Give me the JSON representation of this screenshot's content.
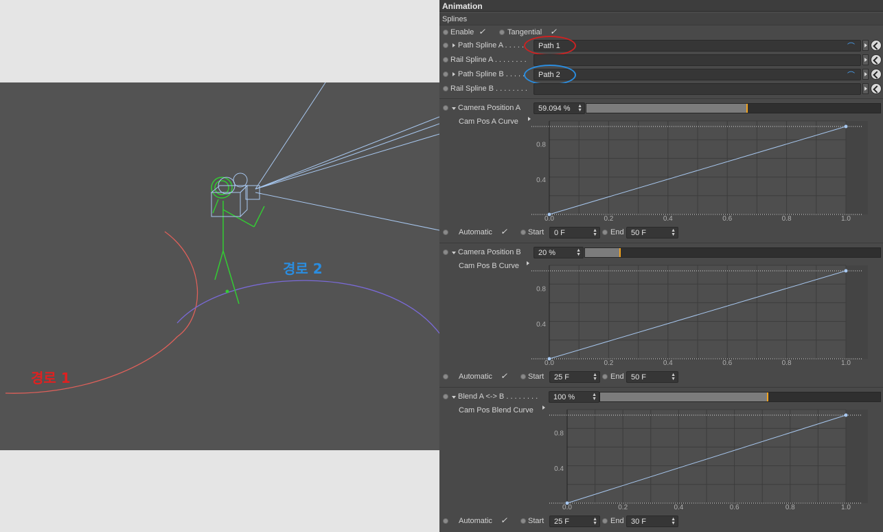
{
  "viewport": {
    "path1_label": "경로 1",
    "path2_label": "경로 2",
    "colors": {
      "path1": "#e0605a",
      "path2": "#7a6ad8",
      "label1": "#e02020",
      "label2": "#2a8de0",
      "figure": "#33cc33",
      "camera": "#a8c8f0",
      "background": "#535353"
    }
  },
  "panel": {
    "title": "Animation",
    "section": "Splines",
    "enable_label": "Enable",
    "tangential_label": "Tangential",
    "check_glyph": "✓",
    "path_spline_a_label": "Path Spline A . . . . .",
    "path_spline_a_value": "Path 1",
    "rail_spline_a_label": "Rail Spline A . . . . . . . .",
    "path_spline_b_label": "Path Spline B . . . . .",
    "path_spline_b_value": "Path 2",
    "rail_spline_b_label": "Rail Spline B . . . . . . . .",
    "highlight_colors": {
      "a": "#cc2222",
      "b": "#2a8de0"
    },
    "blocks": [
      {
        "param_label": "Camera Position A",
        "param_value": "59.094 %",
        "fill_fraction": 0.55,
        "curve_label": "Cam Pos A Curve",
        "automatic_label": "Automatic",
        "start_label": "Start",
        "start_value": "0 F",
        "end_label": "End",
        "end_value": "50 F",
        "y_ticks": [
          "0.8",
          "0.4"
        ],
        "x_ticks": [
          "0.0",
          "0.2",
          "0.4",
          "0.6",
          "0.8",
          "1.0"
        ]
      },
      {
        "param_label": "Camera Position B",
        "param_value": "20 %",
        "fill_fraction": 0.12,
        "curve_label": "Cam Pos B Curve",
        "automatic_label": "Automatic",
        "start_label": "Start",
        "start_value": "25 F",
        "end_label": "End",
        "end_value": "50 F",
        "y_ticks": [
          "0.8",
          "0.4"
        ],
        "x_ticks": [
          "0.0",
          "0.2",
          "0.4",
          "0.6",
          "0.8",
          "1.0"
        ]
      },
      {
        "param_label": "Blend A <-> B . . . . . . . .",
        "param_value": "100 %",
        "fill_fraction": 0.6,
        "curve_label": "Cam Pos Blend Curve",
        "automatic_label": "Automatic",
        "start_label": "Start",
        "start_value": "25 F",
        "end_label": "End",
        "end_value": "30 F",
        "y_ticks": [
          "0.8",
          "0.4"
        ],
        "x_ticks": [
          "0.0",
          "0.2",
          "0.4",
          "0.6",
          "0.8",
          "1.0"
        ]
      }
    ]
  }
}
